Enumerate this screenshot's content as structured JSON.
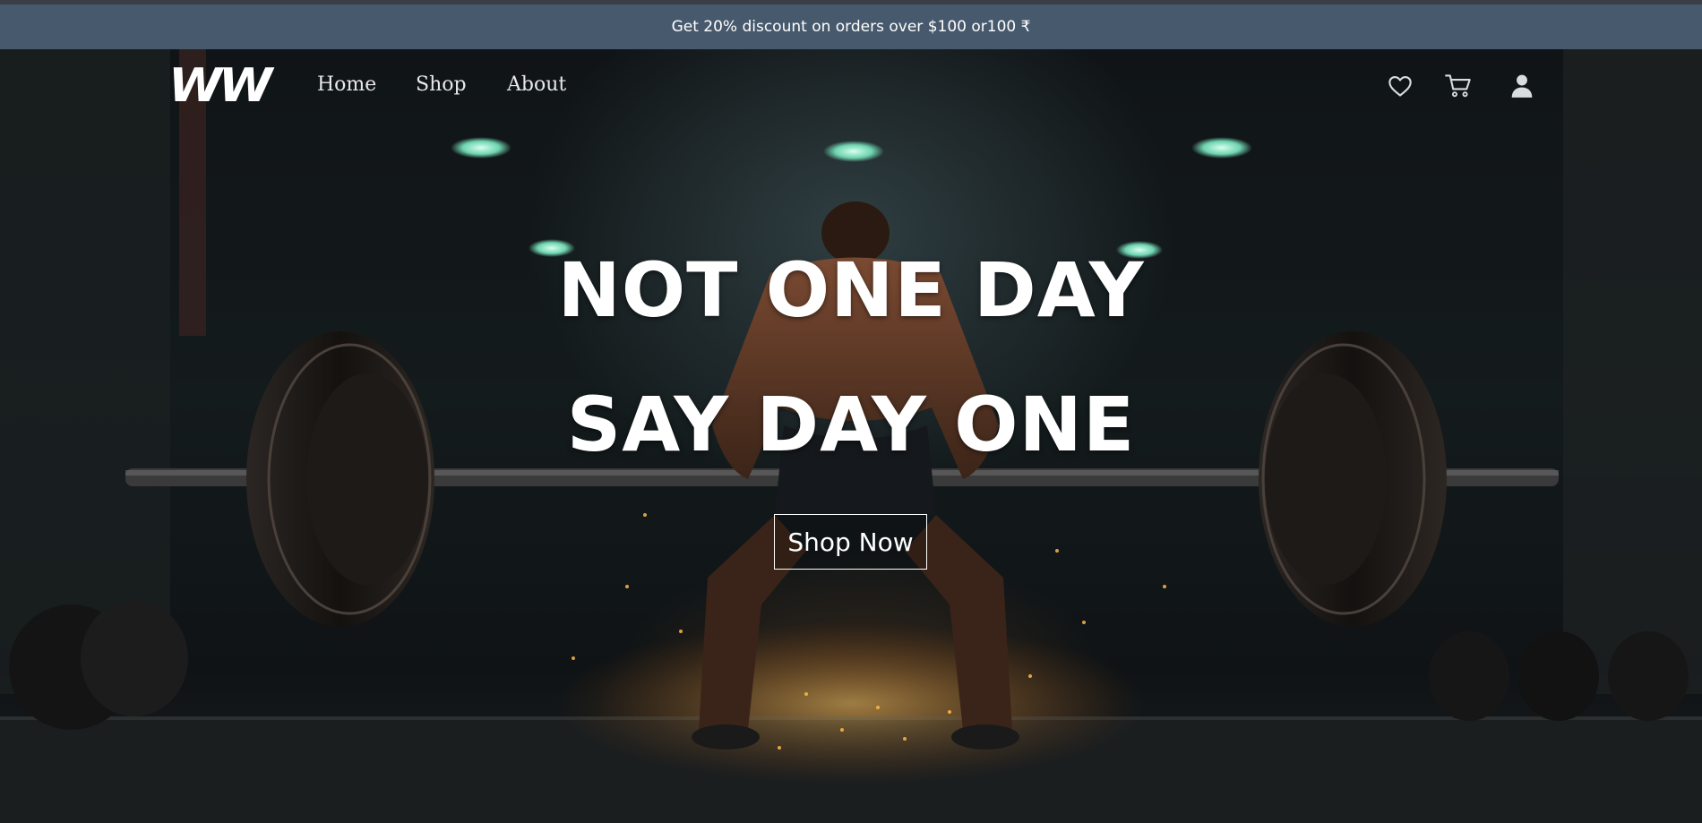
{
  "promo": {
    "text": "Get 20% discount on orders over $100 or100 ₹"
  },
  "header": {
    "logo": "WW",
    "nav": [
      {
        "label": "Home"
      },
      {
        "label": "Shop"
      },
      {
        "label": "About"
      }
    ],
    "icons": [
      "heart-icon",
      "cart-icon",
      "user-icon"
    ]
  },
  "hero": {
    "headline_line1": "NOT ONE DAY",
    "headline_line2": "SAY DAY ONE",
    "cta_label": "Shop Now"
  },
  "colors": {
    "promo_bg": "#47596d",
    "text": "#ffffff",
    "icon": "#d9dde2"
  }
}
